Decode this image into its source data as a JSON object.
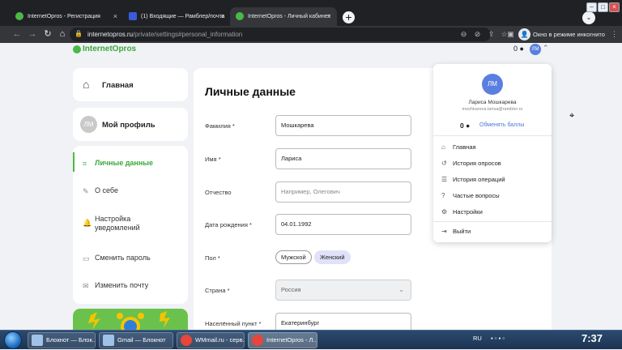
{
  "browser": {
    "tabs": [
      {
        "title": "InternetOpros - Регистрация",
        "favicon_color": "#4cb847",
        "active": false
      },
      {
        "title": "(1) Входящие — Рамблер/почта",
        "favicon_color": "#3b5bdb",
        "active": false
      },
      {
        "title": "InternetOpros - Личный кабинет",
        "favicon_color": "#4cb847",
        "active": true
      }
    ],
    "tab_close": "×",
    "newtab": "+",
    "url_domain": "internetopros.ru",
    "url_path": "/private/settings#personal_information",
    "incognito_label": "Окно в режиме инкогнито",
    "icons": {
      "back": "←",
      "forward": "→",
      "reload": "↻",
      "home": "⌂",
      "lock": "🔒",
      "zoom": "⊖",
      "eye_off": "⊘",
      "share": "⇪",
      "star": "☆",
      "sidebar": "▣",
      "incognito": "👤",
      "menu": "⋮",
      "tab_menu": "⌄"
    },
    "window_controls": [
      "–",
      "□",
      "×"
    ]
  },
  "header": {
    "logo": "InternetOpros",
    "balance": "0",
    "coin": "●",
    "avatar": "ЛМ",
    "chevron": "⌃"
  },
  "sidebar": {
    "home": {
      "label": "Главная",
      "icon": "⌂"
    },
    "profile": {
      "label": "Мой профиль",
      "avatar": "ЛМ"
    },
    "menu": [
      {
        "label": "Личные данные",
        "icon": "⌗",
        "active": true
      },
      {
        "label": "О себе",
        "icon": "✎",
        "active": false
      },
      {
        "label": "Настройка уведомлений",
        "icon": "🔔",
        "active": false
      },
      {
        "label": "Сменить пароль",
        "icon": "▭",
        "active": false
      },
      {
        "label": "Изменить почту",
        "icon": "✉",
        "active": false
      }
    ]
  },
  "form": {
    "title": "Личные данные",
    "fields": [
      {
        "label": "Фамилия *",
        "value": "Мошкарева",
        "placeholder": ""
      },
      {
        "label": "Имя *",
        "value": "Лариса",
        "placeholder": ""
      },
      {
        "label": "Отчество",
        "value": "",
        "placeholder": "Например, Олегович"
      },
      {
        "label": "Дата рождения *",
        "value": "04.01.1992",
        "placeholder": ""
      }
    ],
    "gender": {
      "label": "Пол *",
      "options": [
        "Мужской",
        "Женский"
      ],
      "selected": "Женский"
    },
    "country": {
      "label": "Страна *",
      "value": "Россия",
      "chevron": "⌄"
    },
    "city": {
      "label": "Населённый пункт *",
      "value": "Екатеринбург"
    }
  },
  "dropdown": {
    "avatar": "ЛМ",
    "name": "Лариса Мошкарева",
    "email": "moshkareva.larisa@rambler.ru",
    "balance": "0",
    "coin": "●",
    "exchange": "Обменять баллы",
    "items": [
      {
        "label": "Главная",
        "icon": "⌂"
      },
      {
        "label": "История опросов",
        "icon": "↺"
      },
      {
        "label": "История операций",
        "icon": "☰"
      },
      {
        "label": "Частые вопросы",
        "icon": "?"
      },
      {
        "label": "Настройки",
        "icon": "⚙"
      }
    ],
    "logout": {
      "label": "Выйти",
      "icon": "⇥"
    }
  },
  "taskbar": {
    "items": [
      {
        "label": "Блокнот — Блок...",
        "color": "#9fc3e8",
        "active": false
      },
      {
        "label": "Gmail — Блокнот",
        "color": "#9fc3e8",
        "active": false
      },
      {
        "label": "WMmail.ru - серв...",
        "color": "#e8453c",
        "active": false
      },
      {
        "label": "InternetOpros - Л...",
        "color": "#e8453c",
        "active": true
      }
    ],
    "lang": "RU",
    "clock": "7:37"
  }
}
